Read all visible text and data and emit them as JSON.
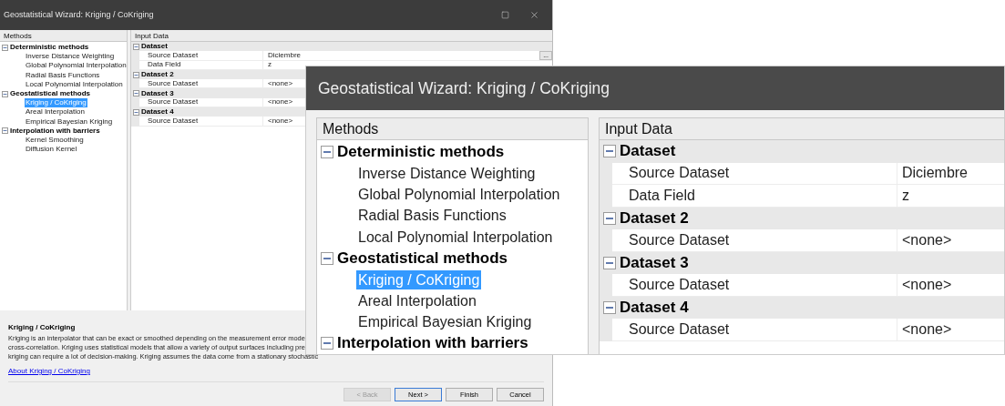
{
  "window": {
    "title": "Geostatistical Wizard: Kriging / CoKriging"
  },
  "methods_panel": {
    "header": "Methods",
    "groups": [
      {
        "label": "Deterministic methods",
        "expanded": true,
        "children": [
          {
            "label": "Inverse Distance Weighting",
            "selected": false
          },
          {
            "label": "Global Polynomial Interpolation",
            "selected": false
          },
          {
            "label": "Radial Basis Functions",
            "selected": false
          },
          {
            "label": "Local Polynomial Interpolation",
            "selected": false
          }
        ]
      },
      {
        "label": "Geostatistical methods",
        "expanded": true,
        "children": [
          {
            "label": "Kriging / CoKriging",
            "selected": true
          },
          {
            "label": "Areal Interpolation",
            "selected": false
          },
          {
            "label": "Empirical Bayesian Kriging",
            "selected": false
          }
        ]
      },
      {
        "label": "Interpolation with barriers",
        "expanded": true,
        "children": [
          {
            "label": "Kernel Smoothing",
            "selected": false
          },
          {
            "label": "Diffusion Kernel",
            "selected": false
          }
        ]
      }
    ]
  },
  "input_panel": {
    "header": "Input Data",
    "categories": [
      {
        "label": "Dataset",
        "expanded": true,
        "rows": [
          {
            "name": "Source Dataset",
            "value": "Diciembre",
            "browse": "..."
          },
          {
            "name": "Data Field",
            "value": "z"
          }
        ]
      },
      {
        "label": "Dataset 2",
        "expanded": true,
        "rows": [
          {
            "name": "Source Dataset",
            "value": "<none>"
          }
        ]
      },
      {
        "label": "Dataset 3",
        "expanded": true,
        "rows": [
          {
            "name": "Source Dataset",
            "value": "<none>"
          }
        ]
      },
      {
        "label": "Dataset 4",
        "expanded": true,
        "rows": [
          {
            "name": "Source Dataset",
            "value": "<none>"
          }
        ]
      }
    ]
  },
  "description": {
    "title": "Kriging / CoKriging",
    "lines": [
      "Kriging is an interpolator that can be exact or smoothed depending on the measurement error mode",
      "cross-correlation. Kriging uses statistical models that allow a variety of output surfaces including pre",
      "kriging can require a lot of decision-making. Kriging assumes the data come from a stationary stochastic"
    ]
  },
  "about_link": "About Kriging / CoKriging",
  "buttons": [
    {
      "label": "< Back",
      "disabled": true,
      "default": false
    },
    {
      "label": "Next >",
      "disabled": false,
      "default": true
    },
    {
      "label": "Finish",
      "disabled": false,
      "default": false
    },
    {
      "label": "Cancel",
      "disabled": false,
      "default": false
    }
  ],
  "zoom_callout": {
    "title": "Geostatistical Wizard: Kriging / CoKriging",
    "methods_panel": {
      "header": "Methods",
      "groups": [
        {
          "label": "Deterministic methods",
          "expanded": true,
          "children": [
            {
              "label": "Inverse Distance Weighting",
              "selected": false
            },
            {
              "label": "Global Polynomial Interpolation",
              "selected": false
            },
            {
              "label": "Radial Basis Functions",
              "selected": false
            },
            {
              "label": "Local Polynomial Interpolation",
              "selected": false
            }
          ]
        },
        {
          "label": "Geostatistical methods",
          "expanded": true,
          "children": [
            {
              "label": "Kriging / CoKriging",
              "selected": true
            },
            {
              "label": "Areal Interpolation",
              "selected": false
            },
            {
              "label": "Empirical Bayesian Kriging",
              "selected": false
            }
          ]
        },
        {
          "label": "Interpolation with barriers",
          "expanded": true
        }
      ]
    },
    "input_panel": {
      "header": "Input Data",
      "categories": [
        {
          "label": "Dataset",
          "expanded": true,
          "rows": [
            {
              "name": "Source Dataset",
              "value": "Diciembre"
            },
            {
              "name": "Data Field",
              "value": "z"
            }
          ]
        },
        {
          "label": "Dataset 2",
          "expanded": true,
          "rows": [
            {
              "name": "Source Dataset",
              "value": "<none>"
            }
          ]
        },
        {
          "label": "Dataset 3",
          "expanded": true,
          "rows": [
            {
              "name": "Source Dataset",
              "value": "<none>"
            }
          ]
        },
        {
          "label": "Dataset 4",
          "expanded": true,
          "rows": [
            {
              "name": "Source Dataset",
              "value": "<none>"
            }
          ]
        }
      ]
    }
  }
}
